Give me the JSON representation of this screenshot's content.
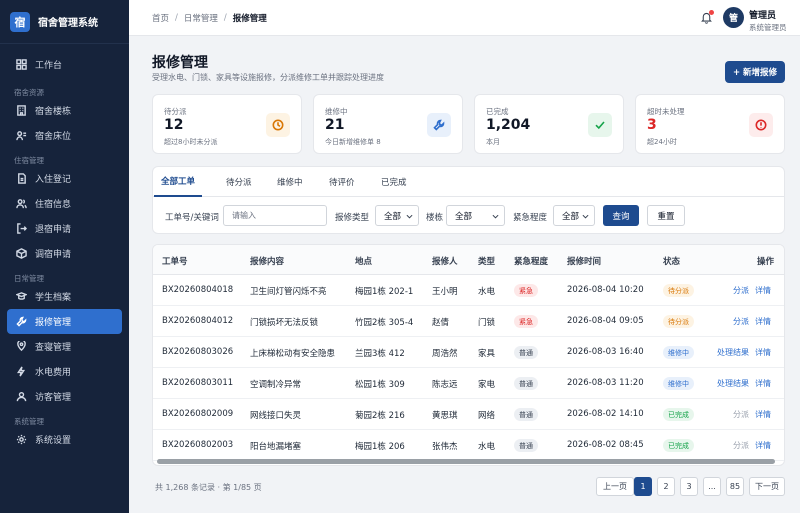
{
  "app": {
    "logo_char": "宿",
    "name": "宿舍管理系统"
  },
  "sidebar": {
    "groups": [
      {
        "label": "",
        "items": [
          {
            "label": "工作台",
            "icon": "dashboard-icon"
          }
        ]
      },
      {
        "label": "宿舍资源",
        "items": [
          {
            "label": "宿舍楼栋",
            "icon": "building-icon"
          },
          {
            "label": "宿舍床位",
            "icon": "bed-icon"
          }
        ]
      },
      {
        "label": "住宿管理",
        "items": [
          {
            "label": "入住登记",
            "icon": "checkin-icon"
          },
          {
            "label": "住宿信息",
            "icon": "users-icon"
          },
          {
            "label": "退宿申请",
            "icon": "checkout-icon"
          },
          {
            "label": "调宿申请",
            "icon": "transfer-icon"
          }
        ]
      },
      {
        "label": "日常管理",
        "items": [
          {
            "label": "学生档案",
            "icon": "student-icon"
          },
          {
            "label": "报修管理",
            "icon": "wrench-icon",
            "active": true
          },
          {
            "label": "查寝管理",
            "icon": "inspection-icon"
          },
          {
            "label": "水电费用",
            "icon": "utility-icon"
          },
          {
            "label": "访客管理",
            "icon": "visitor-icon"
          }
        ]
      },
      {
        "label": "系统管理",
        "items": [
          {
            "label": "系统设置",
            "icon": "gear-icon"
          }
        ]
      }
    ]
  },
  "header": {
    "breadcrumb": [
      "首页",
      "日常管理",
      "报修管理"
    ],
    "avatar_char": "管",
    "user_name": "管理员",
    "user_role": "系统管理员"
  },
  "page": {
    "title": "报修管理",
    "description": "受理水电、门锁、家具等设施报修，分派维修工单并跟踪处理进度",
    "add_button": "+ 新增报修"
  },
  "stats": [
    {
      "label": "待分派",
      "value": "12",
      "sub": "超过8小时未分派",
      "icon": "clock-icon",
      "color": "#d97706",
      "bg": "#fdf3e3"
    },
    {
      "label": "维修中",
      "value": "21",
      "sub": "今日新增维修单 8",
      "icon": "wrench-icon",
      "color": "#2f6fce",
      "bg": "#e8f0fb"
    },
    {
      "label": "已完成",
      "value": "1,204",
      "sub": "本月",
      "icon": "check-icon",
      "color": "#16a34a",
      "bg": "#e7f6ec"
    },
    {
      "label": "超时未处理",
      "value": "3",
      "sub": "超24小时",
      "icon": "alert-icon",
      "color": "#dc2626",
      "bg": "#fdecec"
    }
  ],
  "tabs": [
    "全部工单",
    "待分派",
    "维修中",
    "待评价",
    "已完成"
  ],
  "filters": {
    "keyword_label": "工单号/关键词",
    "keyword_placeholder": "请输入",
    "type_label": "报修类型",
    "type_value": "全部",
    "building_label": "楼栋",
    "building_value": "全部",
    "urgency_label": "紧急程度",
    "urgency_value": "全部",
    "query_button": "查询",
    "reset_button": "重置"
  },
  "table": {
    "columns": [
      "工单号",
      "报修内容",
      "地点",
      "报修人",
      "类型",
      "紧急程度",
      "报修时间",
      "状态",
      "操作"
    ],
    "rows": [
      {
        "id": "BX20260804018",
        "content": "卫生间灯管闪烁不亮",
        "location": "梅园1栋 202-1",
        "reporter": "王小明",
        "type": "水电",
        "urgency": "紧急",
        "urgency_level": "urgent",
        "time": "2026-08-04 10:20",
        "status": "待分派",
        "status_kind": "pending",
        "action1": "分派",
        "action1_muted": false,
        "action2": "详情"
      },
      {
        "id": "BX20260804012",
        "content": "门锁损坏无法反锁",
        "location": "竹园2栋 305-4",
        "reporter": "赵倩",
        "type": "门锁",
        "urgency": "紧急",
        "urgency_level": "urgent",
        "time": "2026-08-04 09:05",
        "status": "待分派",
        "status_kind": "pending",
        "action1": "分派",
        "action1_muted": false,
        "action2": "详情"
      },
      {
        "id": "BX20260803026",
        "content": "上床梯松动有安全隐患",
        "location": "兰园3栋 412",
        "reporter": "周浩然",
        "type": "家具",
        "urgency": "普通",
        "urgency_level": "normal",
        "time": "2026-08-03 16:40",
        "status": "维修中",
        "status_kind": "progress",
        "action1": "处理结果",
        "action1_muted": false,
        "action2": "详情"
      },
      {
        "id": "BX20260803011",
        "content": "空调制冷异常",
        "location": "松园1栋 309",
        "reporter": "陈志远",
        "type": "家电",
        "urgency": "普通",
        "urgency_level": "normal",
        "time": "2026-08-03 11:20",
        "status": "维修中",
        "status_kind": "progress",
        "action1": "处理结果",
        "action1_muted": false,
        "action2": "详情"
      },
      {
        "id": "BX20260802009",
        "content": "网线接口失灵",
        "location": "菊园2栋 216",
        "reporter": "黄思琪",
        "type": "网络",
        "urgency": "普通",
        "urgency_level": "normal",
        "time": "2026-08-02 14:10",
        "status": "已完成",
        "status_kind": "done",
        "action1": "分派",
        "action1_muted": true,
        "action2": "详情"
      },
      {
        "id": "BX20260802003",
        "content": "阳台地漏堵塞",
        "location": "梅园1栋 206",
        "reporter": "张伟杰",
        "type": "水电",
        "urgency": "普通",
        "urgency_level": "normal",
        "time": "2026-08-02 08:45",
        "status": "已完成",
        "status_kind": "done",
        "action1": "分派",
        "action1_muted": true,
        "action2": "详情"
      }
    ]
  },
  "pagination": {
    "summary": "共 1,268 条记录 · 第 1/85 页",
    "prev": "上一页",
    "pages": [
      "1",
      "2",
      "3",
      "...",
      "85"
    ],
    "current": "1",
    "next": "下一页"
  },
  "colors": {
    "sidebar_bg": "#16233b",
    "accent": "#2f6fce",
    "primary_button": "#1e4b8f",
    "urgent_bg": "#fde8e8",
    "urgent_fg": "#dc2626",
    "normal_bg": "#eceff3",
    "normal_fg": "#374151",
    "pending_bg": "#fdf3e3",
    "pending_fg": "#d97706",
    "progress_bg": "#e8f0fb",
    "progress_fg": "#2f6fce",
    "done_bg": "#e7f6ec",
    "done_fg": "#16a34a"
  }
}
